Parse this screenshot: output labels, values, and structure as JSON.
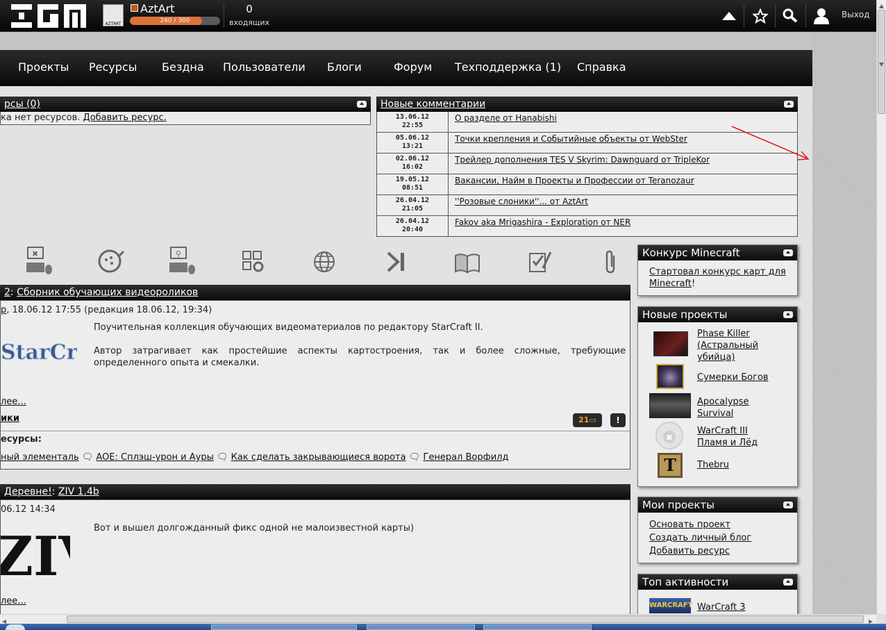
{
  "topbar": {
    "logo": "XGM",
    "avatar_text": "AZTART",
    "username": "AztArt",
    "xp_text": "240 / 300",
    "xp_fraction": 0.8,
    "inbox_count": "0",
    "inbox_label": "входящих",
    "icons": [
      "triangle-up-icon",
      "star-icon",
      "search-icon",
      "user-icon"
    ],
    "logout_label": "Выход"
  },
  "nav": {
    "items": [
      "Проекты",
      "Ресурсы",
      "Бездна",
      "Пользователи",
      "Блоги",
      "Форум",
      "Техподдержка (1)",
      "Справка"
    ]
  },
  "resources_panel": {
    "title": "рсы (0)",
    "text_prefix": "ка нет ресурсов.",
    "add_link": "Добавить ресурс."
  },
  "comments_panel": {
    "title": "Новые комментарии",
    "rows": [
      {
        "date": "13.06.12",
        "time": "22:55",
        "text": "О разделе от Hanabishi"
      },
      {
        "date": "05.06.12",
        "time": "13:21",
        "text": "Точки крепления и Событийные объекты от WebSter"
      },
      {
        "date": "02.06.12",
        "time": "16:02",
        "text": "Трейлер дополнения TES V Skyrim: Dawnguard от TripleKor"
      },
      {
        "date": "19.05.12",
        "time": "08:51",
        "text": "Вакансии, Найм в Проекты и Профессии от Teranozaur"
      },
      {
        "date": "26.04.12",
        "time": "21:05",
        "text": "''Розовые слоники''... от AztArt"
      },
      {
        "date": "26.04.12",
        "time": "20:40",
        "text": "Fakov aka Mrigashira - Exploration от NER"
      }
    ]
  },
  "category_icons": [
    "keyboard-mouse-x-icon",
    "gamepad-icon",
    "keyboard-mouse-figure-icon",
    "grid-gear-icon",
    "globe-icon",
    "play-skip-icon",
    "book-icon",
    "checklist-icon",
    "paperclip-icon"
  ],
  "article1": {
    "title_prefix": "2",
    "title_sep": ":",
    "title": "Сборник обучающих видеороликов",
    "meta_author": "р",
    "meta": ", 18.06.12 17:55 (редакция 18.06.12, 19:34)",
    "image_text": "StarCraft",
    "para1": "Поучительная коллекция обучающих видеоматериалов по редактору StarCraft II.",
    "para2": "Автор затрагивает как простейшие аспекты картостроения, так и более сложные, требующие определенного опыта и смекалки.",
    "more": "лее...",
    "tag": "ики",
    "comment_count": "21",
    "flag": "!",
    "resources_label": "есурсы:",
    "resources": [
      "ный элементаль",
      "AOE: Сплэш-урон и Ауры",
      "Как сделать закрывающиеся ворота",
      "Генерал Ворфилд"
    ]
  },
  "article2": {
    "title_prefix": "Деревне!",
    "title_sep": ":",
    "title": "ZIV 1.4b",
    "meta": "06.12 14:34",
    "image_text": "ZIV",
    "para1": "Вот и вышел долгожданный фикс одной не малоизвестной карты)",
    "more": "лее..."
  },
  "sidebar": {
    "contest": {
      "title": "Конкурс Minecraft",
      "link": "Стартовал конкурс карт для Minecraft",
      "suffix": "!"
    },
    "new_projects": {
      "title": "Новые проекты",
      "items": [
        {
          "name_lines": [
            "Phase Killer",
            "(Астральный",
            "убийца)"
          ],
          "thumb": "phase-killer-thumb"
        },
        {
          "name_lines": [
            "Сумерки Богов"
          ],
          "thumb": "sumerki-thumb"
        },
        {
          "name_lines": [
            "Apocalypse",
            "Survival"
          ],
          "thumb": "apocalypse-thumb"
        },
        {
          "name_lines": [
            "WarCraft III",
            "Пламя и Лёд"
          ],
          "thumb": "no-logo-thumb"
        },
        {
          "name_lines": [
            "Thebru"
          ],
          "thumb": "thebru-thumb"
        }
      ]
    },
    "my_projects": {
      "title": "Мои проекты",
      "links": [
        "Основать проект",
        "Создать личный блог",
        "Добавить ресурс"
      ]
    },
    "top_activity": {
      "title": "Топ активности",
      "first": "WarCraft 3"
    }
  }
}
